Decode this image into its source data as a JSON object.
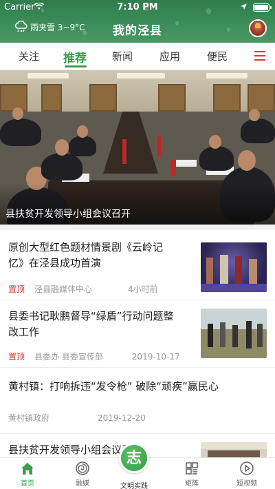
{
  "status": {
    "carrier": "Carrier",
    "time": "7:10 PM"
  },
  "header": {
    "weather_text": "雨夹雪 3~9°C",
    "title": "我的泾县"
  },
  "tabs": [
    {
      "label": "关注",
      "active": false
    },
    {
      "label": "推荐",
      "active": true
    },
    {
      "label": "新闻",
      "active": false
    },
    {
      "label": "应用",
      "active": false
    },
    {
      "label": "便民",
      "active": false
    }
  ],
  "hero": {
    "caption": "县扶贫开发领导小组会议召开"
  },
  "news": [
    {
      "title_line1": "原创大型红色题材情景剧《云岭记",
      "title_line2": "忆》在泾县成功首演",
      "pin": "置顶",
      "source": "泾县融媒体中心",
      "time": "4小时前"
    },
    {
      "title_line1": "县委书记耿鹏督导“绿盾”行动问题整",
      "title_line2": "改工作",
      "pin": "置顶",
      "source": "县委办 县委宣传部",
      "time": "2019-10-17"
    },
    {
      "title_line1": "黄村镇：打响拆违“发令枪” 破除“顽疾”赢民心",
      "source": "黄村镇政府",
      "time": "2019-12-20"
    },
    {
      "title_line1": "县扶贫开发领导小组会议召开"
    }
  ],
  "bottom_nav": [
    {
      "label": "首页",
      "icon": "home-icon",
      "active": true
    },
    {
      "label": "融媒",
      "icon": "swirl-icon",
      "active": false
    },
    {
      "label": "文明实践",
      "icon": "zhi-badge-icon",
      "center_glyph": "志",
      "active": false
    },
    {
      "label": "矩阵",
      "icon": "grid-icon",
      "active": false
    },
    {
      "label": "短视频",
      "icon": "play-icon",
      "active": false
    }
  ],
  "colors": {
    "accent_green": "#3a9d4a",
    "header_green": "#3c8d59",
    "pin_red": "#e0342e"
  }
}
